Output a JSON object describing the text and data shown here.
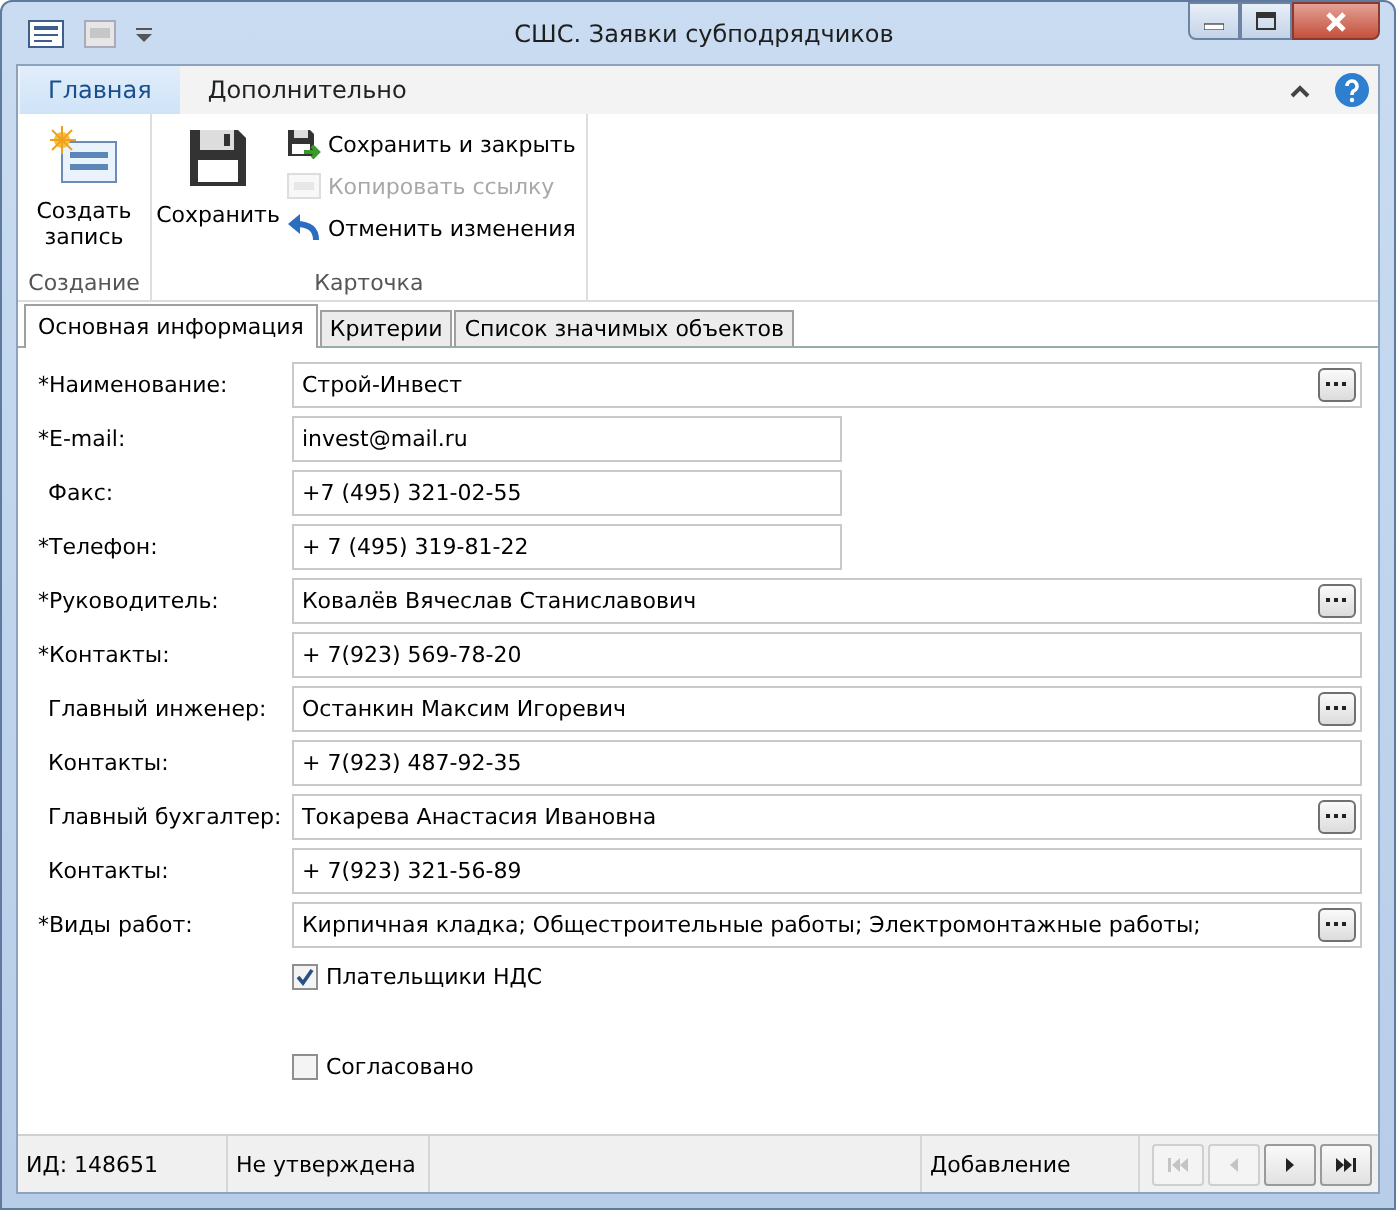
{
  "window": {
    "title": "СШС. Заявки субподрядчиков"
  },
  "ribbon": {
    "tabs": [
      {
        "label": "Главная",
        "selected": true
      },
      {
        "label": "Дополнительно",
        "selected": false
      }
    ],
    "groups": [
      {
        "label": "Создание",
        "buttons": [
          {
            "kind": "large",
            "label": "Создать запись",
            "disabled": false
          }
        ]
      },
      {
        "label": "Карточка",
        "buttons": [
          {
            "kind": "large",
            "label": "Сохранить",
            "disabled": false
          },
          {
            "kind": "small",
            "label": "Сохранить и закрыть",
            "disabled": false
          },
          {
            "kind": "small",
            "label": "Копировать ссылку",
            "disabled": true
          },
          {
            "kind": "small",
            "label": "Отменить изменения",
            "disabled": false
          }
        ]
      }
    ]
  },
  "doc_tabs": [
    {
      "label": "Основная информация",
      "selected": true
    },
    {
      "label": "Критерии",
      "selected": false
    },
    {
      "label": "Список значимых объектов",
      "selected": false
    }
  ],
  "fields": [
    {
      "label": "*Наименование:",
      "required": true,
      "kind": "lookup",
      "value": "Строй-Инвест"
    },
    {
      "label": "*E-mail:",
      "required": true,
      "kind": "short",
      "value": "invest@mail.ru"
    },
    {
      "label": "Факс:",
      "required": false,
      "kind": "short",
      "value": "+7 (495) 321-02-55"
    },
    {
      "label": "*Телефон:",
      "required": true,
      "kind": "short",
      "value": "+ 7 (495) 319-81-22"
    },
    {
      "label": "*Руководитель:",
      "required": true,
      "kind": "lookup",
      "value": "Ковалёв Вячеслав Станиславович"
    },
    {
      "label": "*Контакты:",
      "required": true,
      "kind": "text",
      "value": "+ 7(923) 569-78-20"
    },
    {
      "label": "Главный инженер:",
      "required": false,
      "kind": "lookup",
      "value": "Останкин Максим Игоревич"
    },
    {
      "label": "Контакты:",
      "required": false,
      "kind": "text",
      "value": "+ 7(923) 487-92-35"
    },
    {
      "label": "Главный бухгалтер:",
      "required": false,
      "kind": "lookup",
      "value": "Токарева Анастасия Ивановна"
    },
    {
      "label": "Контакты:",
      "required": false,
      "kind": "text",
      "value": "+ 7(923) 321-56-89"
    },
    {
      "label": "*Виды работ:",
      "required": true,
      "kind": "lookup",
      "value": "Кирпичная кладка; Общестроительные работы; Электромонтажные работы;"
    }
  ],
  "checkboxes": [
    {
      "label": "Плательщики НДС",
      "checked": true
    },
    {
      "label": "Согласовано",
      "checked": false
    }
  ],
  "status_bar": {
    "id": "ИД: 148651",
    "state": "Не утверждена",
    "mode": "Добавление",
    "nav": [
      {
        "kind": "first",
        "disabled": true
      },
      {
        "kind": "prev",
        "disabled": true
      },
      {
        "kind": "next",
        "disabled": false
      },
      {
        "kind": "last",
        "disabled": false
      }
    ]
  }
}
